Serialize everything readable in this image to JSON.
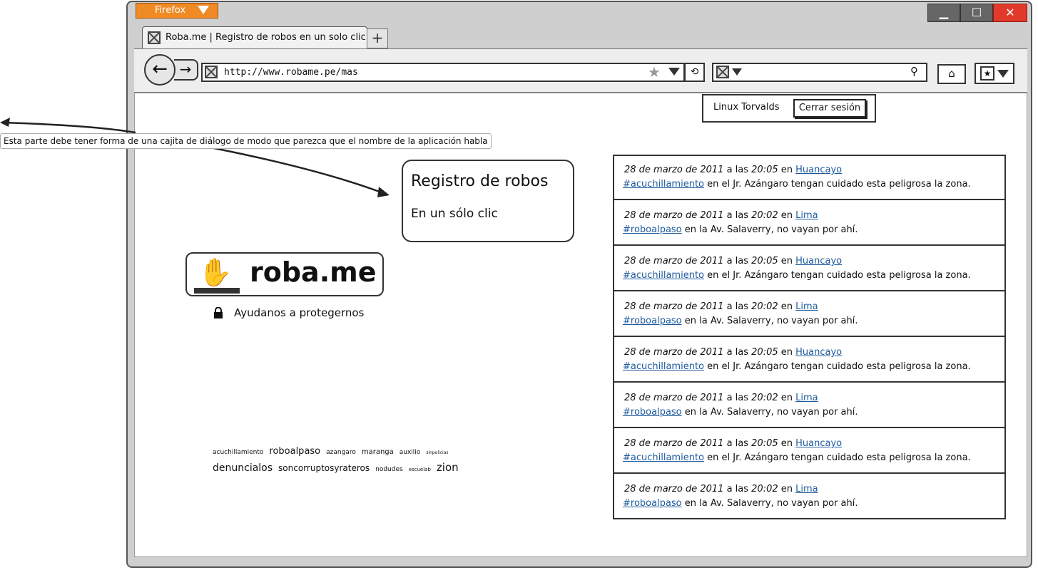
{
  "browser": {
    "menu_button": "Firefox",
    "tab_title": "Roba.me | Registro de robos en un solo clic",
    "new_tab": "+",
    "url": "http://www.robame.pe/mas",
    "window_controls": {
      "minimize": "▁",
      "maximize": "☐",
      "close": "✕"
    }
  },
  "session": {
    "user_name": "Linux Torvalds",
    "logout_label": "Cerrar sesión"
  },
  "annotation": "Esta parte debe tener forma de una cajita de diálogo de modo que parezca que el nombre de la aplicación habla",
  "speech": {
    "title": "Registro de robos",
    "subtitle": "En un sólo clic"
  },
  "logo": {
    "name": "roba.me",
    "tagline": "Ayudanos a protegernos"
  },
  "tag_cloud": [
    {
      "text": "acuchillamiento",
      "size": 9
    },
    {
      "text": "roboalpaso",
      "size": 13
    },
    {
      "text": "azangaro",
      "size": 9
    },
    {
      "text": "maranga",
      "size": 10
    },
    {
      "text": "auxilio",
      "size": 9
    },
    {
      "text": "sinpolicias",
      "size": 6
    },
    {
      "text": "denuncialos",
      "size": 14
    },
    {
      "text": "soncorruptosyrateros",
      "size": 12
    },
    {
      "text": "nodudes",
      "size": 9
    },
    {
      "text": "escuelab",
      "size": 7
    },
    {
      "text": "zion",
      "size": 15
    }
  ],
  "feed": [
    {
      "date": "28 de marzo de 2011",
      "sep": "a las",
      "time": "20:05",
      "place_prefix": "en",
      "place": "Huancayo",
      "tag": "#acuchillamiento",
      "text": "en el Jr. Azángaro tengan cuidado esta peligrosa la zona."
    },
    {
      "date": "28 de marzo de 2011",
      "sep": "a las",
      "time": "20:02",
      "place_prefix": "en",
      "place": "Lima",
      "tag": "#roboalpaso",
      "text": "en la Av. Salaverry, no vayan por ahí."
    },
    {
      "date": "28 de marzo de 2011",
      "sep": "a las",
      "time": "20:05",
      "place_prefix": "en",
      "place": "Huancayo",
      "tag": "#acuchillamiento",
      "text": "en el Jr. Azángaro tengan cuidado esta peligrosa la zona."
    },
    {
      "date": "28 de marzo de 2011",
      "sep": "a las",
      "time": "20:02",
      "place_prefix": "en",
      "place": "Lima",
      "tag": "#roboalpaso",
      "text": "en la Av. Salaverry, no vayan por ahí."
    },
    {
      "date": "28 de marzo de 2011",
      "sep": "a las",
      "time": "20:05",
      "place_prefix": "en",
      "place": "Huancayo",
      "tag": "#acuchillamiento",
      "text": "en el Jr. Azángaro tengan cuidado esta peligrosa la zona."
    },
    {
      "date": "28 de marzo de 2011",
      "sep": "a las",
      "time": "20:02",
      "place_prefix": "en",
      "place": "Lima",
      "tag": "#roboalpaso",
      "text": "en la Av. Salaverry, no vayan por ahí."
    },
    {
      "date": "28 de marzo de 2011",
      "sep": "a las",
      "time": "20:05",
      "place_prefix": "en",
      "place": "Huancayo",
      "tag": "#acuchillamiento",
      "text": "en el Jr. Azángaro tengan cuidado esta peligrosa la zona."
    },
    {
      "date": "28 de marzo de 2011",
      "sep": "a las",
      "time": "20:02",
      "place_prefix": "en",
      "place": "Lima",
      "tag": "#roboalpaso",
      "text": "en la Av. Salaverry, no vayan por ahí."
    }
  ]
}
